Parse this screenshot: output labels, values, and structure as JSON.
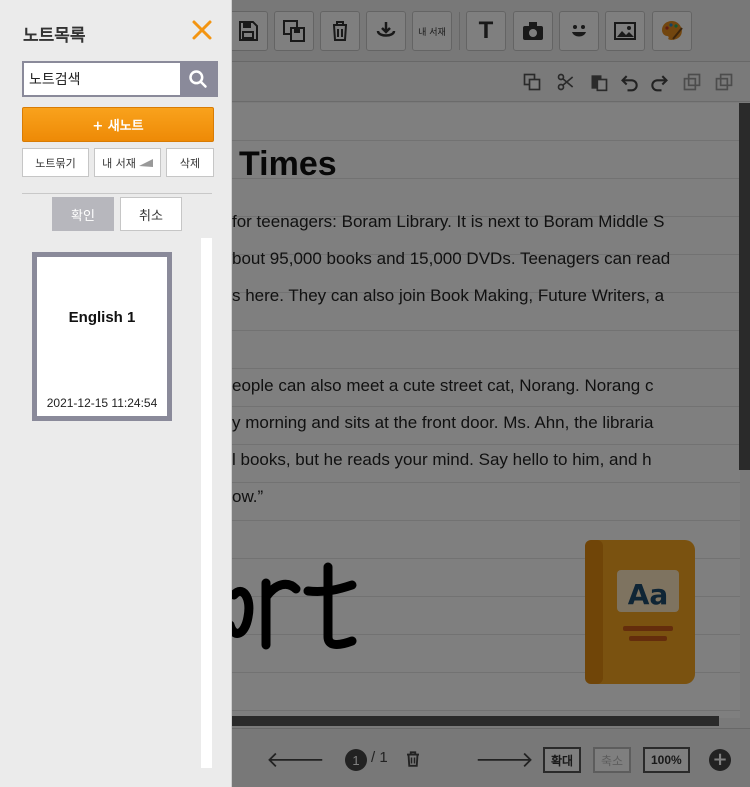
{
  "sidebar": {
    "title": "노트목록",
    "search": {
      "value": "노트검색",
      "placeholder": ""
    },
    "new_note_label": "+ 새노트",
    "buttons": {
      "bind_notes": "노트묶기",
      "my_library": "내 서재",
      "delete": "삭제"
    },
    "confirm_label": "확인",
    "cancel_label": "취소",
    "notes": [
      {
        "title": "English 1",
        "date": "2021-12-15 11:24:54"
      }
    ]
  },
  "toolbar": {
    "my_library_label": "내 서재",
    "text_tool_label": "T"
  },
  "document": {
    "title": "Times",
    "lines": [
      "for teenagers: Boram Library. It is next to Boram Middle S",
      "bout 95,000 books and 15,000 DVDs. Teenagers can read",
      "s here. They can also join Book Making, Future Writers, a",
      "eople can also meet a cute street cat, Norang. Norang c",
      "y morning and sits at the front door. Ms. Ahn, the libraria",
      "l books, but he reads your mind. Say hello to him, and h",
      "ow.”"
    ],
    "handwriting": "ort"
  },
  "pagination": {
    "current": "1",
    "total": "/ 1"
  },
  "zoom": {
    "zoom_in": "확대",
    "zoom_out": "축소",
    "level": "100%"
  },
  "colors": {
    "accent": "#f39512",
    "sidebar_bg": "#ebebeb",
    "close": "#f39512",
    "search_btn": "#8a8a9a"
  }
}
